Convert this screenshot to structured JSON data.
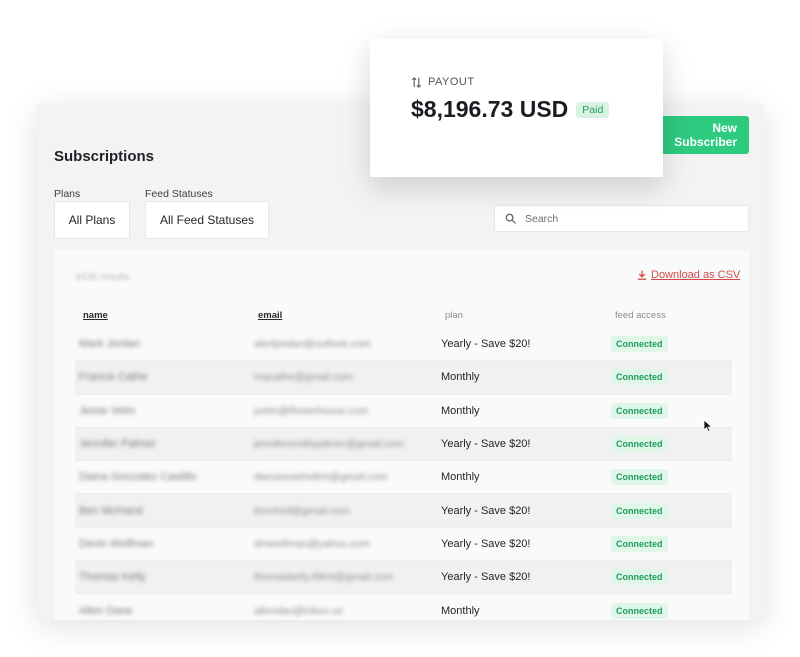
{
  "app": {
    "title": "Subscriptions",
    "new_subscriber_label": "New Subscriber",
    "filters": {
      "plans_label": "Plans",
      "plans_value": "All Plans",
      "feed_label": "Feed Statuses",
      "feed_value": "All Feed Statuses"
    },
    "search": {
      "placeholder": "Search",
      "icon": "search-icon"
    },
    "table": {
      "results_count": "3436 results",
      "download_csv": "Download as CSV",
      "headers": {
        "name": "name",
        "email": "email",
        "plan": "plan",
        "feed": "feed access"
      },
      "rows": [
        {
          "name": "Mark Jordan",
          "email": "alertjordan@outlook.com",
          "plan": "Yearly - Save $20!",
          "feed": "Connected"
        },
        {
          "name": "Francis Cathe",
          "email": "macathe@gmail.com",
          "plan": "Monthly",
          "feed": "Connected"
        },
        {
          "name": "Jesse Velm",
          "email": "jvelm@flowerhouse.com",
          "plan": "Monthly",
          "feed": "Connected"
        },
        {
          "name": "Jennifer Palmer",
          "email": "jennifersmithpalmer@gmail.com",
          "plan": "Yearly - Save $20!",
          "feed": "Connected"
        },
        {
          "name": "Diana Gonzalez Castillo",
          "email": "dianaseashellzh@gmail.com",
          "plan": "Monthly",
          "feed": "Connected"
        },
        {
          "name": "Ben McHand",
          "email": "bmchnd@gmail.com",
          "plan": "Yearly - Save $20!",
          "feed": "Connected"
        },
        {
          "name": "Devin Wolfman",
          "email": "dmwolfman@yahoo.com",
          "plan": "Yearly - Save $20!",
          "feed": "Connected"
        },
        {
          "name": "Thomas Kelly",
          "email": "thomaskelly.8904@gmail.com",
          "plan": "Yearly - Save $20!",
          "feed": "Connected"
        },
        {
          "name": "Allen Dave",
          "email": "allendav@inbox.us",
          "plan": "Monthly",
          "feed": "Connected"
        }
      ]
    }
  },
  "payout": {
    "label": "PAYOUT",
    "amount": "$8,196.73 USD",
    "status": "Paid",
    "icon": "sort-arrows-icon"
  },
  "colors": {
    "accent_green": "#2dcb7f",
    "connected_text": "#1f9c5e",
    "csv_red": "#d14a4a"
  }
}
